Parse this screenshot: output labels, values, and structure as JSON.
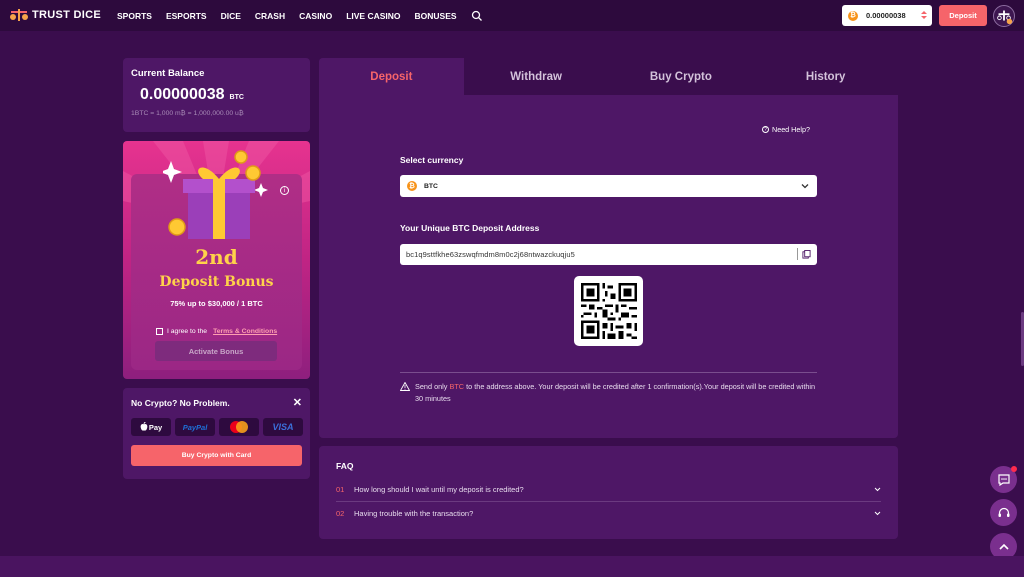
{
  "header": {
    "logo_text": "TRUST DICE",
    "nav": [
      "SPORTS",
      "ESPORTS",
      "DICE",
      "CRASH",
      "CASINO",
      "LIVE CASINO",
      "BONUSES"
    ],
    "wallet_amount": "0.00000038",
    "deposit_label": "Deposit"
  },
  "balance": {
    "title": "Current Balance",
    "amount": "0.00000038",
    "unit": "BTC",
    "conversion": "1BTC = 1,000 m₿ = 1,000,000.00 u₿"
  },
  "bonus": {
    "number": "2nd",
    "title": "Deposit Bonus",
    "subtitle": "75% up to $30,000 / 1 BTC",
    "agree_text": "I agree to the",
    "terms_text": "Terms & Conditions",
    "activate_label": "Activate Bonus"
  },
  "nocrypto": {
    "title": "No Crypto? No Problem.",
    "close": "✕",
    "payments": [
      "Pay",
      "PayPal",
      "",
      "VISA"
    ],
    "buy_label": "Buy Crypto with Card"
  },
  "tabs": [
    {
      "label": "Deposit",
      "active": true
    },
    {
      "label": "Withdraw",
      "active": false
    },
    {
      "label": "Buy Crypto",
      "active": false
    },
    {
      "label": "History",
      "active": false
    }
  ],
  "deposit": {
    "need_help": "Need Help?",
    "select_label": "Select currency",
    "currency": "BTC",
    "address_label": "Your Unique BTC Deposit Address",
    "address": "bc1q9sttfkhe63zswqfmdm8m0c2j68ntwazckuqju5",
    "warning_pre": "Send only ",
    "warning_coin": "BTC",
    "warning_post": " to the address above. Your deposit will be credited after 1 confirmation(s).Your deposit will be credited within 30 minutes"
  },
  "faq": {
    "title": "FAQ",
    "items": [
      {
        "num": "01",
        "q": "How long should I wait until my deposit is credited?"
      },
      {
        "num": "02",
        "q": "Having trouble with the transaction?"
      }
    ]
  },
  "colors": {
    "bg": "#3a0d4d",
    "panel": "#4e1766",
    "accent": "#f6646a",
    "gold": "#ffd24a",
    "btc": "#f7931a"
  }
}
